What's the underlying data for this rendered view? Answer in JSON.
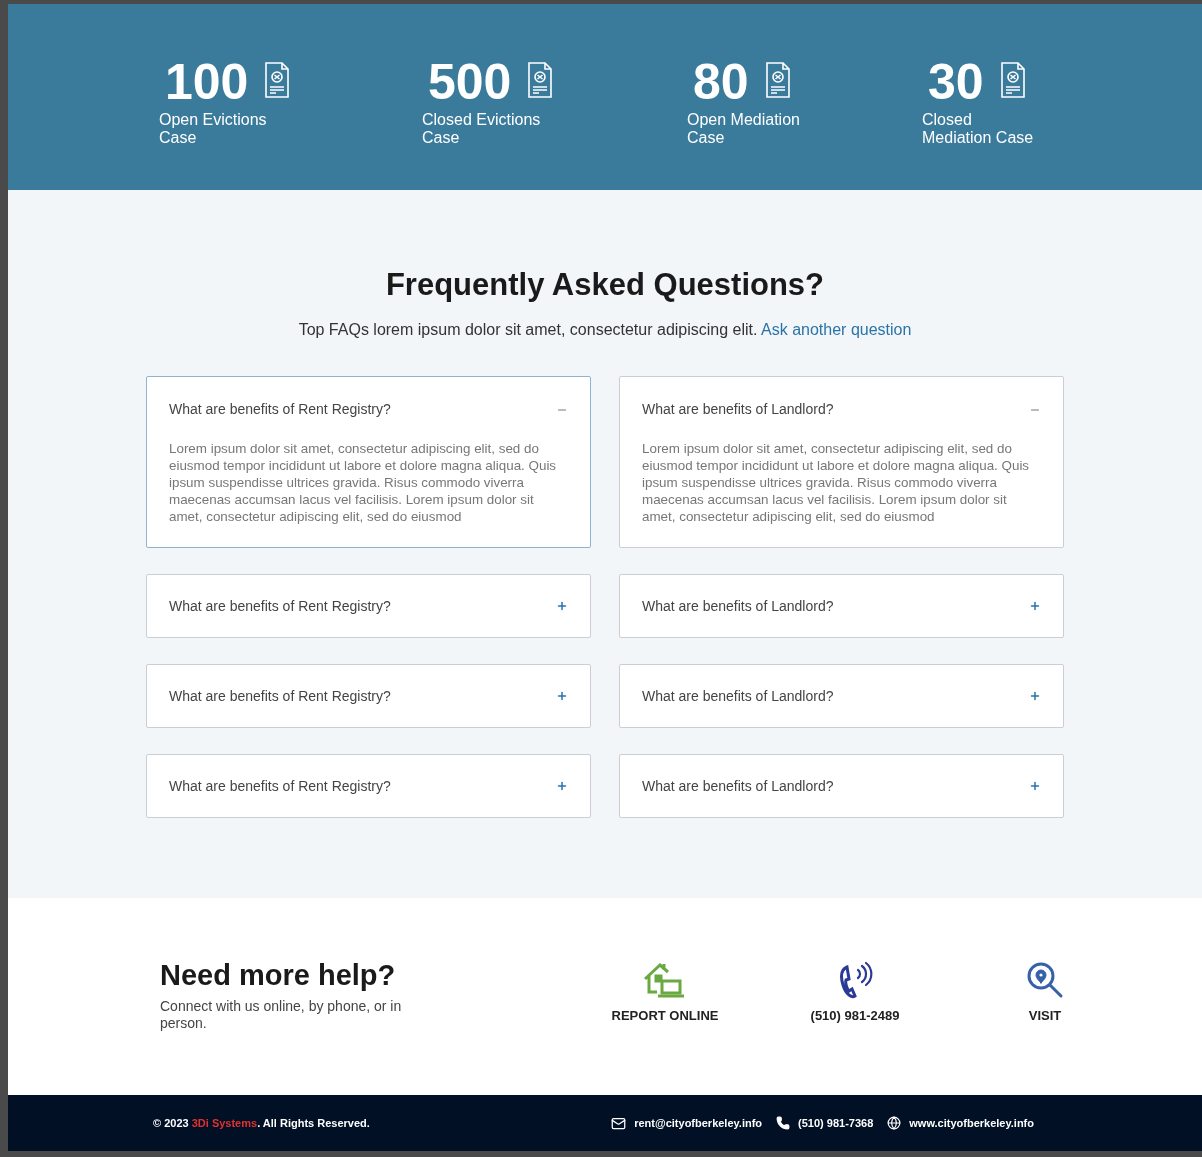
{
  "stats": [
    {
      "value": "100",
      "label": "Open Evictions Case"
    },
    {
      "value": "500",
      "label": "Closed Evictions Case"
    },
    {
      "value": "80",
      "label": "Open Mediation Case"
    },
    {
      "value": "30",
      "label": "Closed Mediation Case"
    }
  ],
  "faq": {
    "title": "Frequently Asked Questions?",
    "intro": "Top FAQs lorem ipsum dolor sit amet, consectetur adipiscing elit.",
    "link": "Ask another question",
    "items": [
      {
        "question": "What are benefits of Rent Registry?",
        "expanded": true,
        "selected": true,
        "answer": "Lorem ipsum dolor sit amet, consectetur adipiscing elit, sed do eiusmod tempor incididunt ut labore et dolore magna aliqua. Quis ipsum suspendisse ultrices gravida. Risus commodo viverra maecenas accumsan lacus vel facilisis. Lorem ipsum dolor sit amet, consectetur adipiscing elit, sed do eiusmod"
      },
      {
        "question": "What are benefits of Landlord?",
        "expanded": true,
        "selected": false,
        "answer": "Lorem ipsum dolor sit amet, consectetur adipiscing elit, sed do eiusmod tempor incididunt ut labore et dolore magna aliqua. Quis ipsum suspendisse ultrices gravida. Risus commodo viverra maecenas accumsan lacus vel facilisis. Lorem ipsum dolor sit amet, consectetur adipiscing elit, sed do eiusmod"
      },
      {
        "question": "What are benefits of Rent Registry?",
        "expanded": false,
        "selected": false
      },
      {
        "question": "What are benefits of Landlord?",
        "expanded": false,
        "selected": false
      },
      {
        "question": "What are benefits of Rent Registry?",
        "expanded": false,
        "selected": false
      },
      {
        "question": "What are benefits of Landlord?",
        "expanded": false,
        "selected": false
      },
      {
        "question": "What are benefits of Rent Registry?",
        "expanded": false,
        "selected": false
      },
      {
        "question": "What are benefits of Landlord?",
        "expanded": false,
        "selected": false
      }
    ]
  },
  "help": {
    "title": "Need more help?",
    "text": "Connect with us online, by phone, or in person.",
    "options": [
      {
        "kind": "report",
        "label": "REPORT ONLINE"
      },
      {
        "kind": "phone",
        "label": "(510) 981-2489"
      },
      {
        "kind": "visit",
        "label": "VISIT"
      }
    ]
  },
  "footer": {
    "copyright_before": "© 2023",
    "brand": "3Di Systems",
    "copyright_after": ". All Rights Reserved.",
    "contacts": [
      {
        "kind": "email",
        "text": "rent@cityofberkeley.info"
      },
      {
        "kind": "phone",
        "text": "(510) 981-7368"
      },
      {
        "kind": "web",
        "text": "www.cityofberkeley.info"
      }
    ]
  }
}
